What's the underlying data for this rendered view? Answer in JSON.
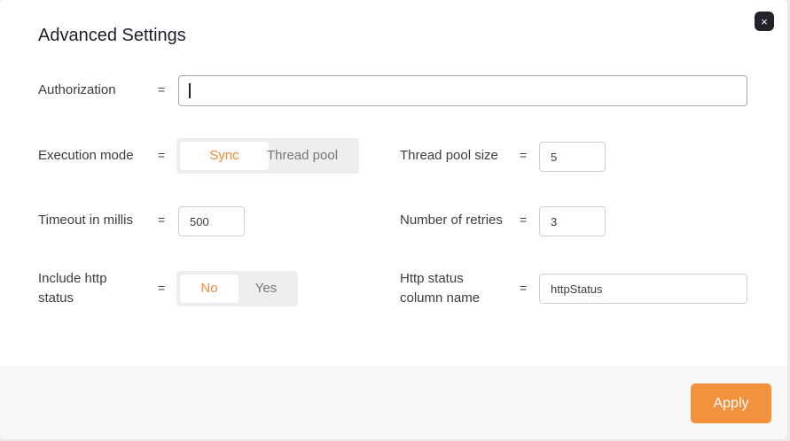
{
  "dialog": {
    "title": "Advanced Settings",
    "close_glyph": "×",
    "close_icon": "close-icon"
  },
  "fields": {
    "equals": "=",
    "authorization": {
      "label": "Authorization",
      "value": ""
    },
    "execution_mode": {
      "label": "Execution mode",
      "options": [
        "Sync",
        "Thread pool"
      ],
      "selected": "Sync"
    },
    "thread_pool_size": {
      "label": "Thread pool size",
      "value": "5"
    },
    "timeout": {
      "label": "Timeout in millis",
      "value": "500"
    },
    "retries": {
      "label": "Number of retries",
      "value": "3"
    },
    "include_http_status": {
      "label_line1": "Include http",
      "label_line2": "status",
      "options": [
        "No",
        "Yes"
      ],
      "selected": "No"
    },
    "http_status_column": {
      "label_line1": "Http status",
      "label_line2": "column name",
      "value": "httpStatus"
    }
  },
  "footer": {
    "apply_label": "Apply"
  },
  "colors": {
    "accent": "#f4913d",
    "active_text": "#f08a35"
  }
}
